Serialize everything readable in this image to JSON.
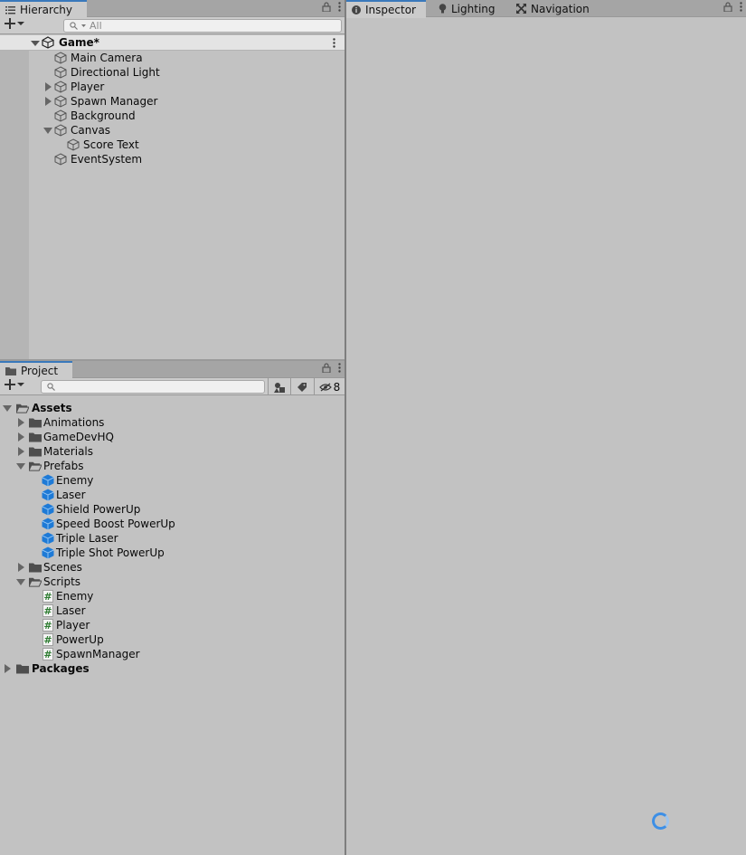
{
  "hierarchy": {
    "tab_label": "Hierarchy",
    "search_placeholder": "All",
    "scene_name": "Game*",
    "items": [
      {
        "label": "Main Camera"
      },
      {
        "label": "Directional Light"
      },
      {
        "label": "Player"
      },
      {
        "label": "Spawn Manager"
      },
      {
        "label": "Background"
      },
      {
        "label": "Canvas"
      },
      {
        "label": "Score Text"
      },
      {
        "label": "EventSystem"
      }
    ]
  },
  "project": {
    "tab_label": "Project",
    "search_placeholder": "",
    "hidden_count": "8",
    "root": "Assets",
    "items": [
      {
        "label": "Animations"
      },
      {
        "label": "GameDevHQ"
      },
      {
        "label": "Materials"
      },
      {
        "label": "Prefabs"
      },
      {
        "label": "Enemy"
      },
      {
        "label": "Laser"
      },
      {
        "label": "Shield PowerUp"
      },
      {
        "label": "Speed Boost PowerUp"
      },
      {
        "label": "Triple Laser"
      },
      {
        "label": "Triple Shot PowerUp"
      },
      {
        "label": "Scenes"
      },
      {
        "label": "Scripts"
      },
      {
        "label": "Enemy"
      },
      {
        "label": "Laser"
      },
      {
        "label": "Player"
      },
      {
        "label": "PowerUp"
      },
      {
        "label": "SpawnManager"
      }
    ],
    "packages": "Packages"
  },
  "inspector": {
    "tabs": [
      {
        "label": "Inspector"
      },
      {
        "label": "Lighting"
      },
      {
        "label": "Navigation"
      }
    ]
  },
  "colors": {
    "panel_bg": "#c2c2c2",
    "tab_bar": "#a5a5a5",
    "active_tab_accent": "#3a79bb",
    "prefab_blue": "#1e7ad6",
    "script_green": "#2f7d32",
    "spinner": "#3d8fe6"
  }
}
